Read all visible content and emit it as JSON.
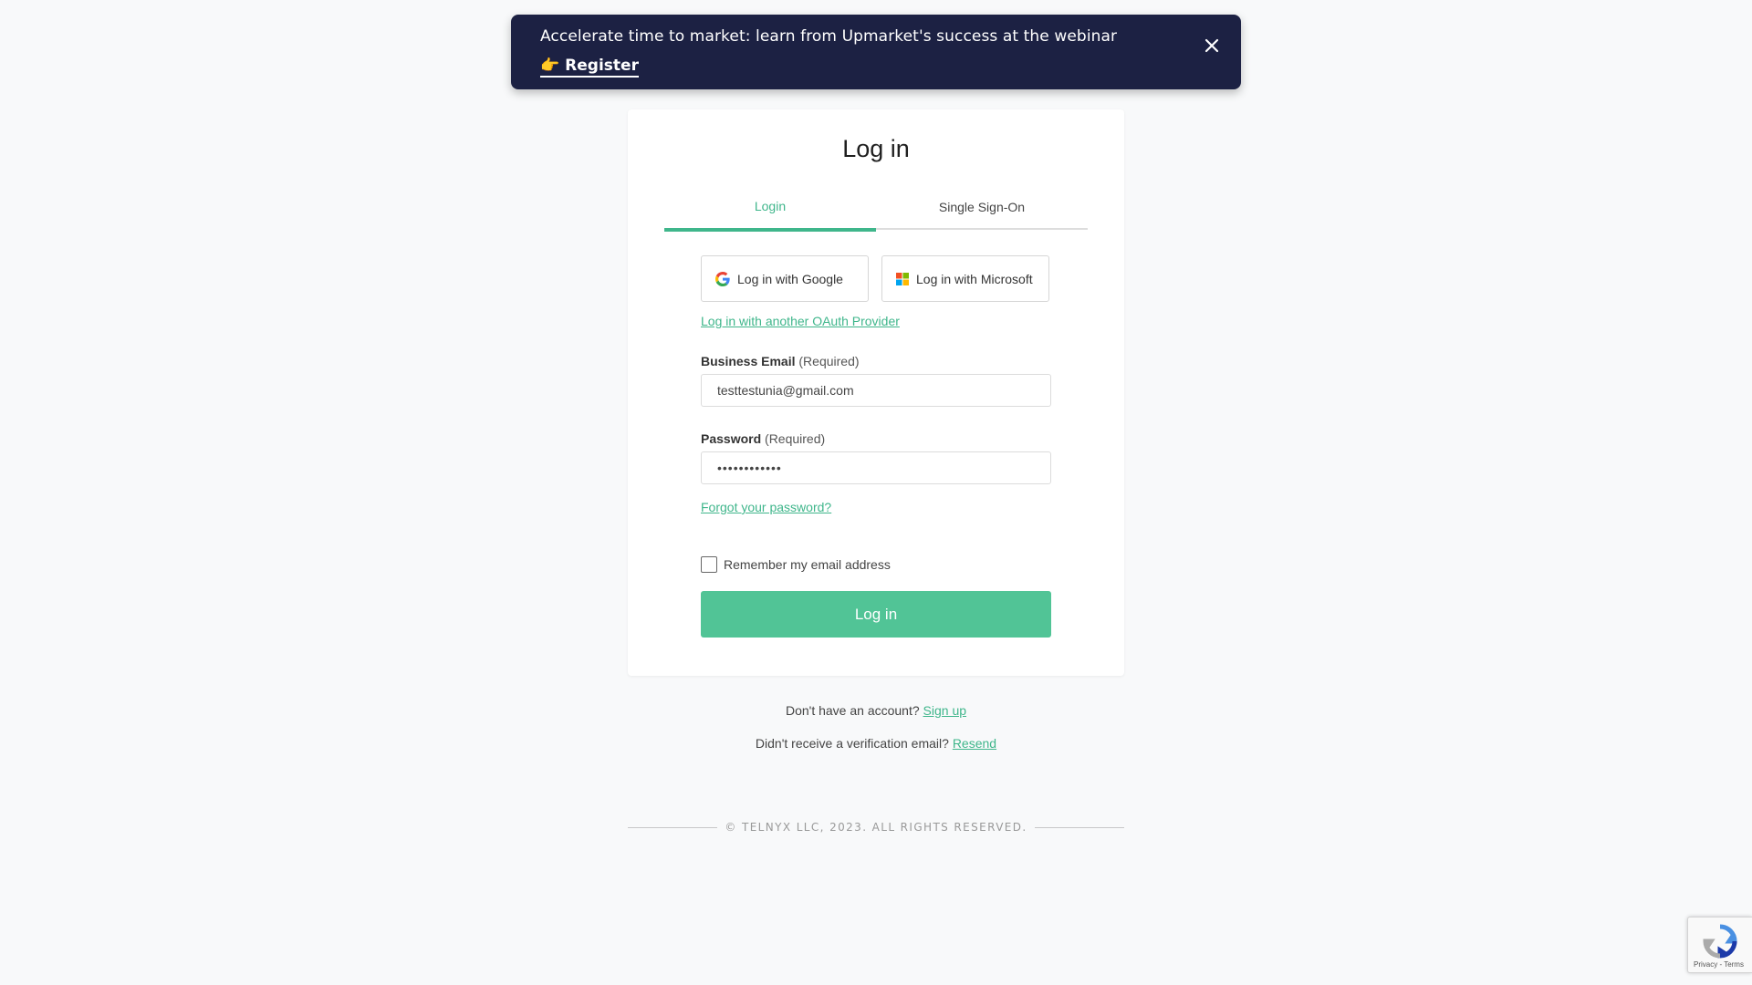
{
  "banner": {
    "text": "Accelerate time to market: learn from Upmarket's success at the webinar",
    "register_label": "Register",
    "register_emoji": "👉",
    "close_icon": "close-icon"
  },
  "card": {
    "title": "Log in",
    "tabs": [
      {
        "label": "Login",
        "active": true
      },
      {
        "label": "Single Sign-On",
        "active": false
      }
    ],
    "oauth": {
      "google_label": "Log in with Google",
      "microsoft_label": "Log in with Microsoft",
      "other_label": "Log in with another OAuth Provider"
    },
    "email": {
      "label": "Business Email",
      "required": "(Required)",
      "value": "testtestunia@gmail.com"
    },
    "password": {
      "label": "Password",
      "required": "(Required)",
      "value": "••••••••••••"
    },
    "forgot_label": "Forgot your password?",
    "remember_label": "Remember my email address",
    "remember_checked": false,
    "submit_label": "Log in"
  },
  "below": {
    "signup_text": "Don't have an account?",
    "signup_link": "Sign up",
    "resend_text": "Didn't receive a verification email?",
    "resend_link": "Resend"
  },
  "footer": {
    "copyright": "© TELNYX LLC, 2023. ALL RIGHTS RESERVED."
  },
  "recaptcha": {
    "terms": "Privacy - Terms"
  },
  "colors": {
    "accent": "#3fb68b",
    "button": "#51c496",
    "banner_bg": "#1c2143",
    "page_bg": "#f8f9fa"
  }
}
